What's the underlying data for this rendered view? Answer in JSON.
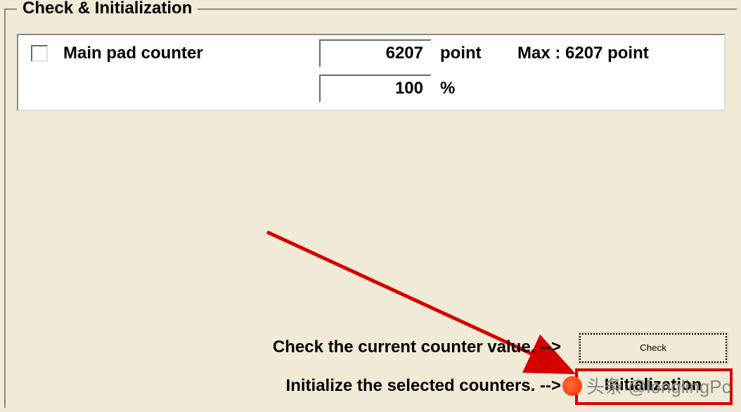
{
  "group": {
    "title": "Check & Initialization"
  },
  "counter": {
    "label": "Main pad counter",
    "points_value": "6207",
    "points_unit": "point",
    "percent_value": "100",
    "percent_unit": "%",
    "max_text": "Max : 6207 point"
  },
  "instructions": {
    "check": "Check the current counter value. -->",
    "init": "Initialize the selected counters. -->"
  },
  "buttons": {
    "check": "Check",
    "init": "Initialization"
  },
  "watermark": "头条 @longlingPc"
}
